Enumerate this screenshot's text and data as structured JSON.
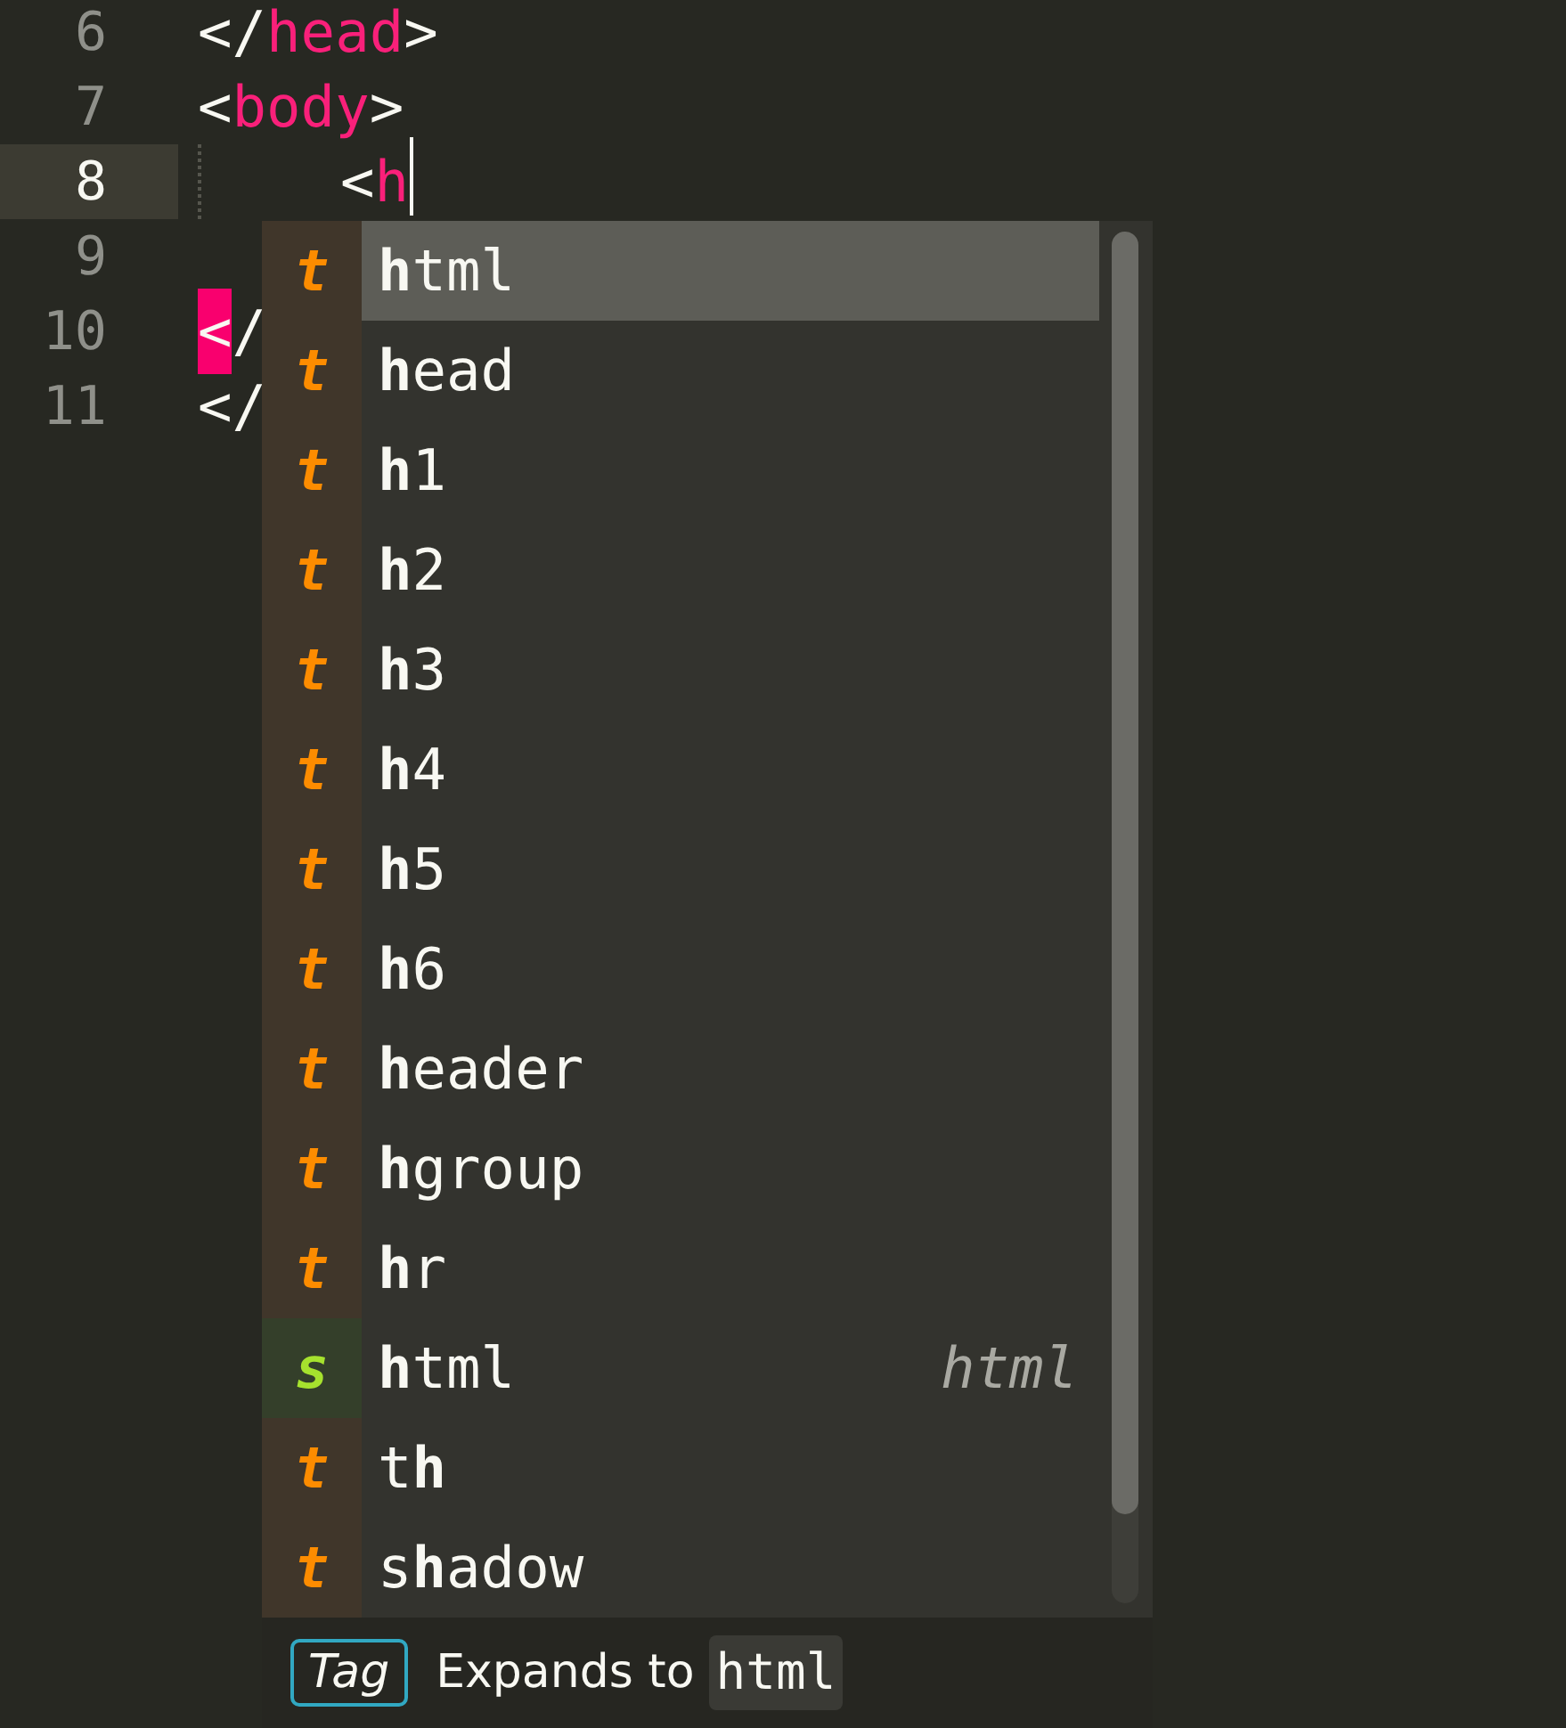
{
  "lines": [
    {
      "number": "6",
      "current": false,
      "tokens": [
        {
          "kind": "punct",
          "text": "</"
        },
        {
          "kind": "tag",
          "text": "head"
        },
        {
          "kind": "punct",
          "text": ">"
        }
      ]
    },
    {
      "number": "7",
      "current": false,
      "tokens": [
        {
          "kind": "punct",
          "text": "<"
        },
        {
          "kind": "tag",
          "text": "body"
        },
        {
          "kind": "punct",
          "text": ">"
        }
      ]
    },
    {
      "number": "8",
      "current": true,
      "indent_guide": true,
      "cursor": true,
      "tokens": [
        {
          "kind": "punct",
          "text": "<"
        },
        {
          "kind": "tag",
          "text": "h"
        }
      ]
    },
    {
      "number": "9",
      "current": false
    },
    {
      "number": "10",
      "current": false,
      "tokens": [
        {
          "kind": "error",
          "text": "<"
        },
        {
          "kind": "punct",
          "text": "/"
        }
      ]
    },
    {
      "number": "11",
      "current": false,
      "tokens": [
        {
          "kind": "punct",
          "text": "</"
        }
      ]
    }
  ],
  "completions": [
    {
      "kind": "tag",
      "letter": "t",
      "label": "**h**tml",
      "selected": true
    },
    {
      "kind": "tag",
      "letter": "t",
      "label": "**h**ead",
      "selected": false
    },
    {
      "kind": "tag",
      "letter": "t",
      "label": "**h**1",
      "selected": false
    },
    {
      "kind": "tag",
      "letter": "t",
      "label": "**h**2",
      "selected": false
    },
    {
      "kind": "tag",
      "letter": "t",
      "label": "**h**3",
      "selected": false
    },
    {
      "kind": "tag",
      "letter": "t",
      "label": "**h**4",
      "selected": false
    },
    {
      "kind": "tag",
      "letter": "t",
      "label": "**h**5",
      "selected": false
    },
    {
      "kind": "tag",
      "letter": "t",
      "label": "**h**6",
      "selected": false
    },
    {
      "kind": "tag",
      "letter": "t",
      "label": "**h**eader",
      "selected": false
    },
    {
      "kind": "tag",
      "letter": "t",
      "label": "**h**group",
      "selected": false
    },
    {
      "kind": "tag",
      "letter": "t",
      "label": "**h**r",
      "selected": false
    },
    {
      "kind": "snippet",
      "letter": "s",
      "label": "**h**tml",
      "selected": false,
      "hint": "html"
    },
    {
      "kind": "tag",
      "letter": "t",
      "label": "t**h**",
      "selected": false
    },
    {
      "kind": "tag",
      "letter": "t",
      "label": "s**h**adow",
      "selected": false
    }
  ],
  "details": {
    "badge": "Tag",
    "text": "Expands to",
    "code": "html"
  }
}
